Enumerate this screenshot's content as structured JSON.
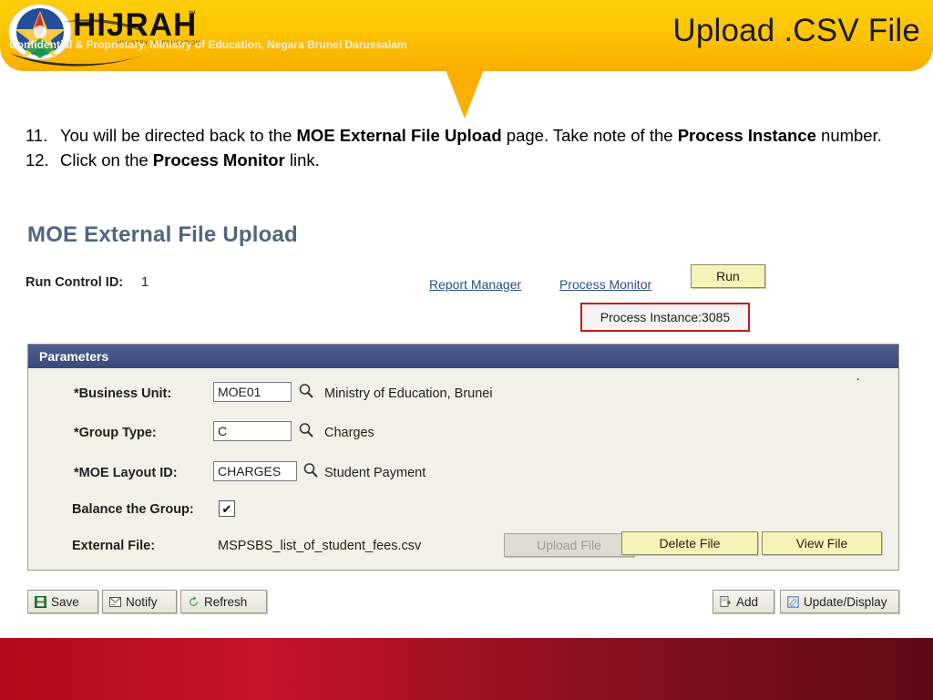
{
  "header": {
    "title": "Upload .CSV File",
    "logo_text": "HIJRAH",
    "logo_tm": "™",
    "logo_sub": "MINISTRY OF EDUCATION"
  },
  "instructions": [
    {
      "number": "11.",
      "parts": [
        {
          "text": "You will be directed back to the ",
          "bold": false
        },
        {
          "text": "MOE External File Upload",
          "bold": true
        },
        {
          "text": " page. Take note of the ",
          "bold": false
        },
        {
          "text": "Process Instance",
          "bold": true
        },
        {
          "text": " number.",
          "bold": false
        }
      ]
    },
    {
      "number": "12.",
      "parts": [
        {
          "text": "Click on the ",
          "bold": false
        },
        {
          "text": "Process Monitor",
          "bold": true
        },
        {
          "text": " link.",
          "bold": false
        }
      ]
    }
  ],
  "screenshot": {
    "page_title": "MOE External File Upload",
    "run_control_label": "Run Control ID:",
    "run_control_value": "1",
    "links": {
      "report_manager": "Report Manager",
      "process_monitor": "Process Monitor"
    },
    "run_button": "Run",
    "process_instance": "Process Instance:3085",
    "panel": {
      "header": "Parameters",
      "corner_dot": ".",
      "rows": [
        {
          "label": "*Business Unit:",
          "value": "MOE01",
          "icon": "lookup-magnifier-icon",
          "description": "Ministry of Education, Brunei"
        },
        {
          "label": "*Group Type:",
          "value": "C",
          "icon": "lookup-magnifier-icon",
          "description": "Charges"
        },
        {
          "label": "*MOE Layout ID:",
          "value": "CHARGES",
          "icon": "lookup-magnifier-icon",
          "description": "Student Payment"
        }
      ],
      "balance_label": "Balance the Group:",
      "balance_checked": "✔",
      "external_file_label": "External File:",
      "external_file_name": "MSPSBS_list_of_student_fees.csv",
      "buttons": {
        "upload": "Upload File",
        "delete": "Delete File",
        "view": "View File"
      }
    },
    "toolbar": {
      "save": "Save",
      "notify": "Notify",
      "refresh": "Refresh",
      "add": "Add",
      "update_display": "Update/Display"
    }
  },
  "footer": {
    "text": "Confidential & Proprietary, Ministry of Education, Negara Brunei Darussalam"
  },
  "colors": {
    "header_yellow": "#fdc505",
    "footer_red": "#c8122a",
    "panel_header_blue": "#3f4f82",
    "highlight_red": "#c21a1a",
    "link_blue": "#2b4f8e"
  }
}
